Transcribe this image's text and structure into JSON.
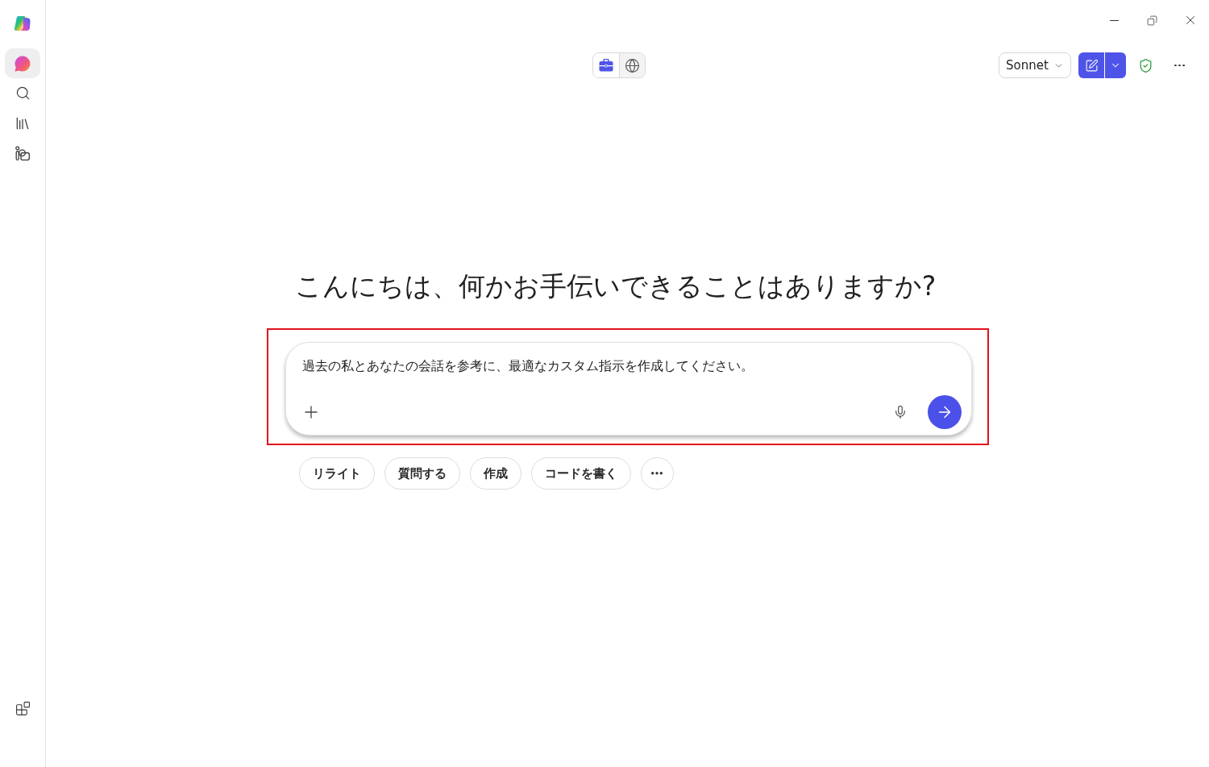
{
  "sidebar": {
    "items": [
      {
        "selected": true
      },
      {
        "selected": false
      },
      {
        "selected": false
      },
      {
        "selected": false
      }
    ]
  },
  "mode_toggle": [
    {
      "selected": true
    },
    {
      "selected": false
    }
  ],
  "model_picker": {
    "value": "Sonnet"
  },
  "greeting": "こんにちは、何かお手伝いできることはありますか?",
  "composer": {
    "value": "過去の私とあなたの会話を参考に、最適なカスタム指示を作成してください。",
    "highlighted": true
  },
  "suggestions": [
    "リライト",
    "質問する",
    "作成",
    "コードを書く"
  ]
}
